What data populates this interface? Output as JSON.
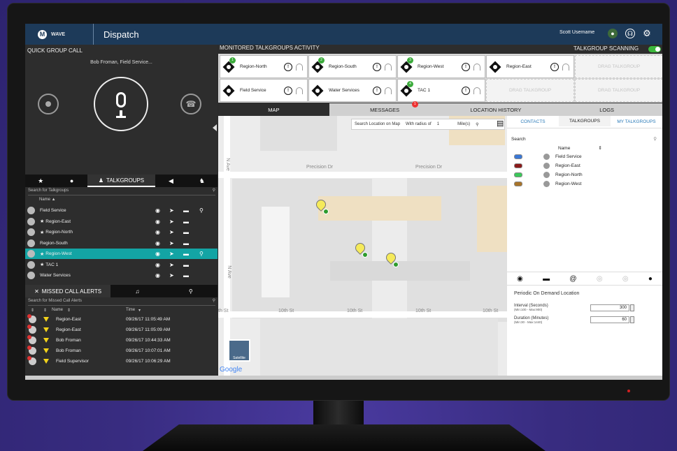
{
  "app": {
    "logo_text": "WAVE",
    "title": "Dispatch",
    "user": "Scott Username"
  },
  "quick_call": {
    "title": "QUICK GROUP CALL",
    "caller": "Bob Froman, Field Service..."
  },
  "talkgroups": {
    "tab_label": "TALKGROUPS",
    "search_placeholder": "Search for Talkgroups",
    "column": "Name",
    "items": [
      {
        "name": "Field Service",
        "starred": false,
        "selected": false
      },
      {
        "name": "Region-East",
        "starred": true,
        "selected": false
      },
      {
        "name": "Region-North",
        "starred": true,
        "selected": false
      },
      {
        "name": "Region-South",
        "starred": false,
        "selected": false
      },
      {
        "name": "Region-West",
        "starred": true,
        "selected": true
      },
      {
        "name": "TAC 1",
        "starred": true,
        "selected": false
      },
      {
        "name": "Water Services",
        "starred": false,
        "selected": false
      }
    ]
  },
  "missed_calls": {
    "tab_label": "MISSED CALL ALERTS",
    "search_placeholder": "Search for Missed Call Alerts",
    "col_name": "Name",
    "col_time": "Time",
    "items": [
      {
        "name": "Region-East",
        "time": "09/26/17 11:05:49 AM"
      },
      {
        "name": "Region-East",
        "time": "09/26/17 11:05:09 AM"
      },
      {
        "name": "Bob Froman",
        "time": "09/26/17 10:44:33 AM"
      },
      {
        "name": "Bob Froman",
        "time": "09/26/17 10:07:01 AM"
      },
      {
        "name": "Field Supervisor",
        "time": "09/26/17 10:06:29 AM"
      }
    ]
  },
  "monitor": {
    "title": "MONITORED TALKGROUPS ACTIVITY",
    "scanning_label": "TALKGROUP SCANNING",
    "tiles": [
      {
        "label": "Region-North",
        "badge": "1"
      },
      {
        "label": "Region-South",
        "badge": "2"
      },
      {
        "label": "Region-West",
        "badge": "3"
      },
      {
        "label": "Region-East",
        "badge": ""
      },
      {
        "label": "Field Service",
        "badge": ""
      },
      {
        "label": "Water Services",
        "badge": ""
      },
      {
        "label": "TAC 1",
        "badge": "4"
      }
    ],
    "drag_label": "DRAG TALKGROUP"
  },
  "view_tabs": {
    "map": "MAP",
    "messages": "MESSAGES",
    "messages_badge": "1",
    "location_history": "LOCATION HISTORY",
    "logs": "LOGS"
  },
  "map": {
    "search_label": "Search Location on Map",
    "radius_label": "With radius of",
    "radius_value": "1",
    "radius_unit": "Mile(s)",
    "streets": [
      "Precision Dr",
      "Precision Dr",
      "N Ave",
      "N Ave",
      "10th St",
      "10th St",
      "10th St",
      "10th St",
      "10th St",
      "th St"
    ],
    "satellite_label": "Satellite",
    "google_label": "Google"
  },
  "contacts": {
    "tabs": [
      "CONTACTS",
      "TALKGROUPS",
      "MY TALKGROUPS"
    ],
    "search_label": "Search",
    "column": "Name",
    "items": [
      {
        "name": "Field Service",
        "color": "#3a78d6"
      },
      {
        "name": "Region-East",
        "color": "#8b1a1a"
      },
      {
        "name": "Region-North",
        "color": "#3cc85a"
      },
      {
        "name": "Region-West",
        "color": "#a8742a"
      }
    ],
    "periodic_title": "Periodic On Demand Location",
    "interval_label": "Interval (Seconds)",
    "interval_hint": "(Min:100 - Max:900)",
    "interval_value": "300",
    "duration_label": "Duration (Minutes)",
    "duration_hint": "(Min:30 - Max:1440)",
    "duration_value": "60"
  },
  "colors": {
    "accent": "#13a4a4",
    "topbar": "#1d3a59",
    "scanning_on": "#3cb83c",
    "backdrop": "#3b2f86"
  }
}
